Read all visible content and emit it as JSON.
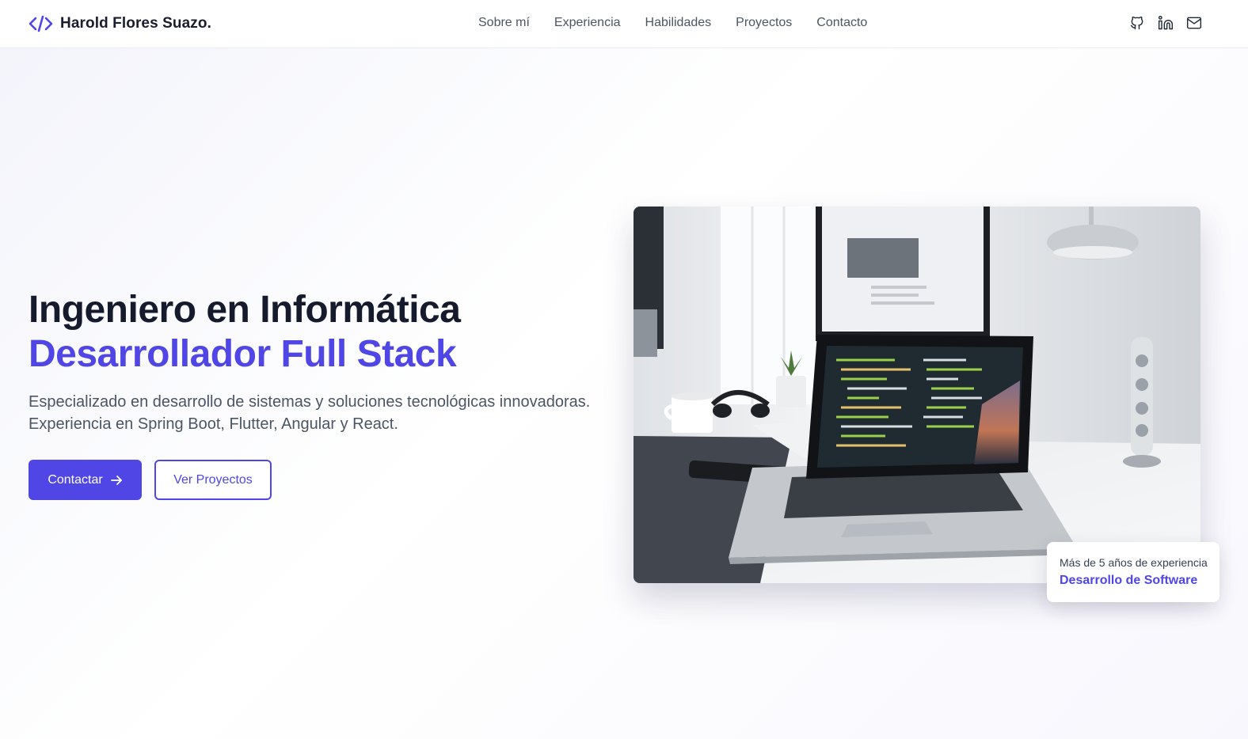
{
  "brand": {
    "name": "Harold Flores Suazo.",
    "icon": "code-icon",
    "accent_color": "#4f46e5"
  },
  "nav": {
    "links": [
      "Sobre mí",
      "Experiencia",
      "Habilidades",
      "Proyectos",
      "Contacto"
    ]
  },
  "socials": {
    "icons": [
      "github-icon",
      "linkedin-icon",
      "mail-icon"
    ]
  },
  "hero": {
    "title_line1": "Ingeniero en Informática",
    "title_line2": "Desarrollador Full Stack",
    "description_line1": "Especializado en desarrollo de sistemas y soluciones tecnológicas innovadoras.",
    "description_line2": "Experiencia en Spring Boot, Flutter, Angular y React.",
    "primary_button": "Contactar",
    "primary_button_icon": "arrow-right-icon",
    "secondary_button": "Ver Proyectos",
    "image": "laptop-desk-photo"
  },
  "badge": {
    "subtitle": "Más de 5 años de experiencia",
    "title": "Desarrollo de Software"
  }
}
